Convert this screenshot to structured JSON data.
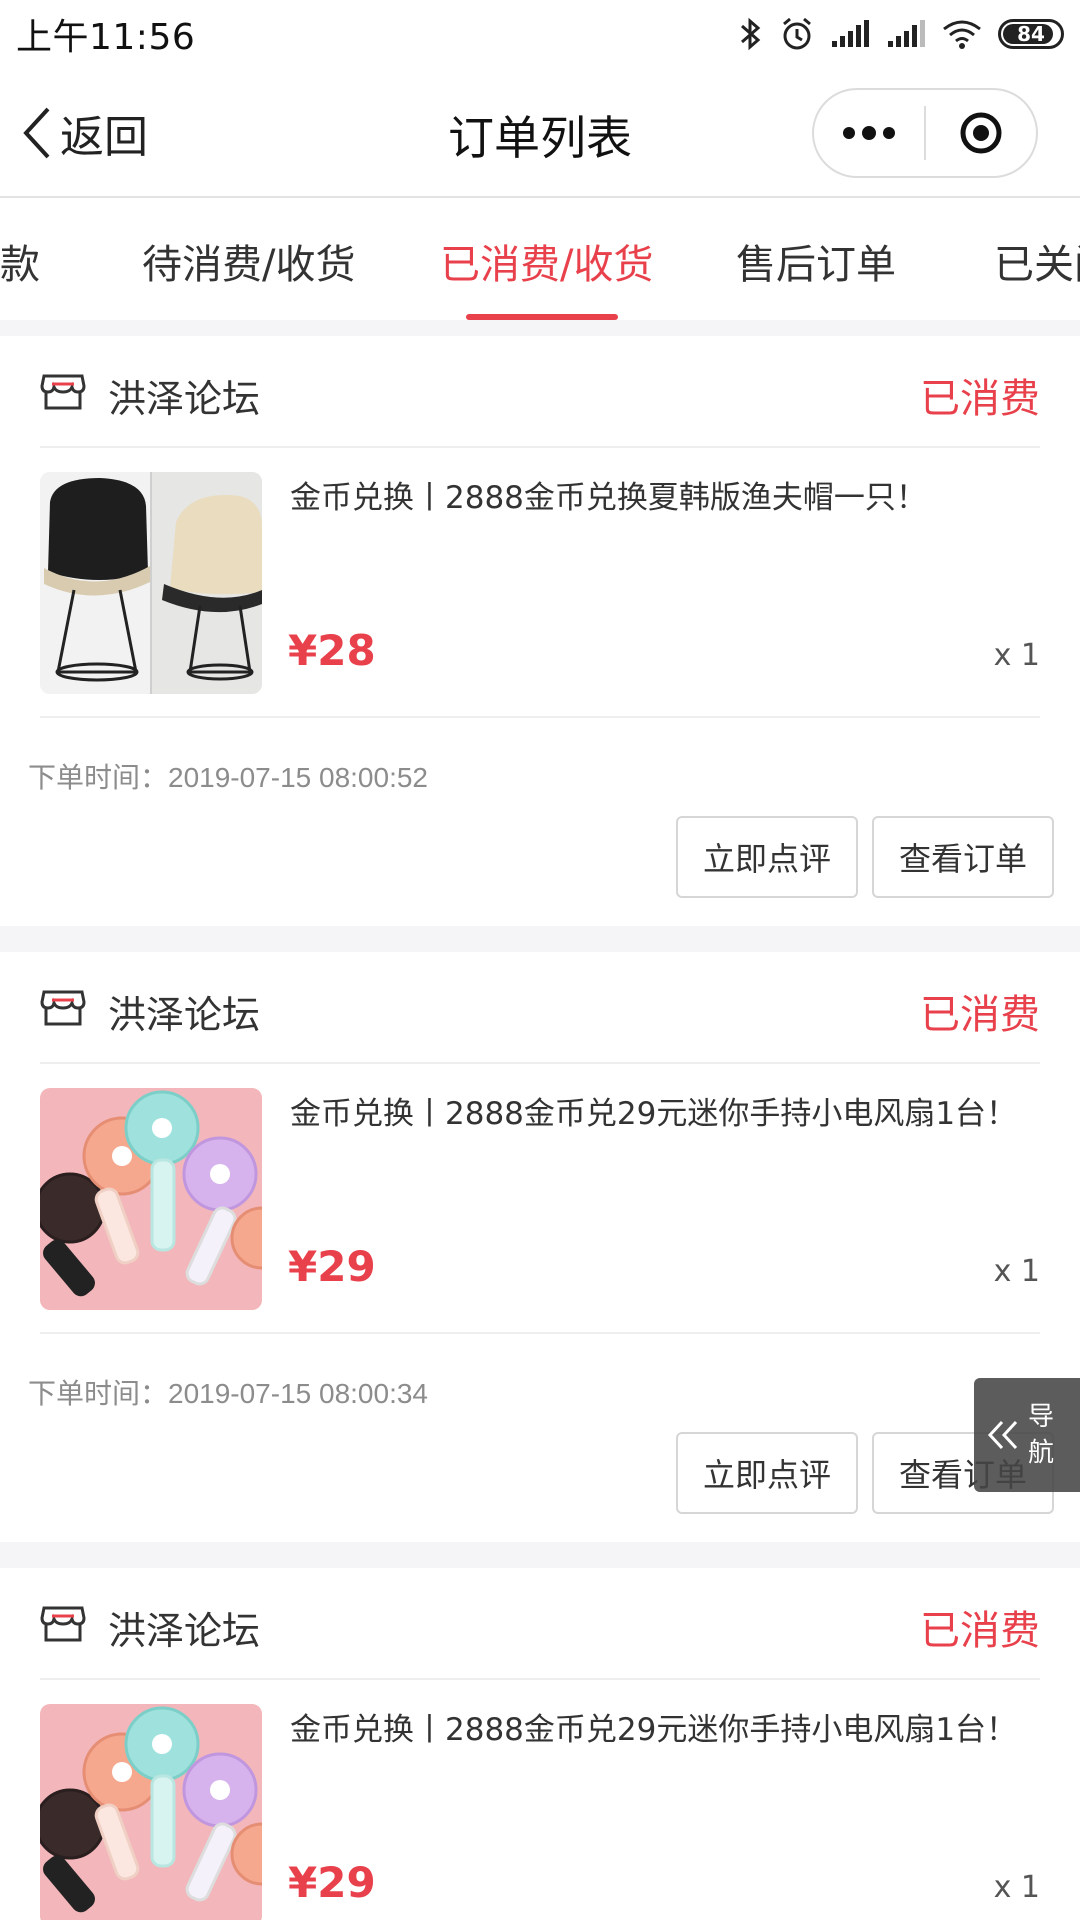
{
  "status_bar": {
    "time": "上午11:56",
    "battery": "84"
  },
  "nav": {
    "back_label": "返回",
    "title": "订单列表"
  },
  "tabs": [
    {
      "label": "款"
    },
    {
      "label": "待消费/收货"
    },
    {
      "label": "已消费/收货",
      "active": true
    },
    {
      "label": "售后订单"
    },
    {
      "label": "已关闭"
    }
  ],
  "orders": [
    {
      "shop": "洪泽论坛",
      "status": "已消费",
      "title": "金币兑换丨2888金币兑换夏韩版渔夫帽一只！",
      "price": "¥28",
      "qty": "x 1",
      "time_label": "下单时间：2019-07-15 08:00:52",
      "btn_review": "立即点评",
      "btn_view": "查看订单",
      "image": "bucket-hat-photo"
    },
    {
      "shop": "洪泽论坛",
      "status": "已消费",
      "title": "金币兑换丨2888金币兑29元迷你手持小电风扇1台！",
      "price": "¥29",
      "qty": "x 1",
      "time_label": "下单时间：2019-07-15 08:00:34",
      "btn_review": "立即点评",
      "btn_view": "查看订单",
      "image": "handheld-fan-photo"
    },
    {
      "shop": "洪泽论坛",
      "status": "已消费",
      "title": "金币兑换丨2888金币兑29元迷你手持小电风扇1台！",
      "price": "¥29",
      "qty": "x 1",
      "image": "handheld-fan-photo"
    }
  ],
  "float_nav": {
    "label": "导航",
    "icon": "double-chevron-left-icon"
  },
  "colors": {
    "accent": "#e8414c",
    "text": "#333333",
    "muted": "#8c8c8c"
  }
}
